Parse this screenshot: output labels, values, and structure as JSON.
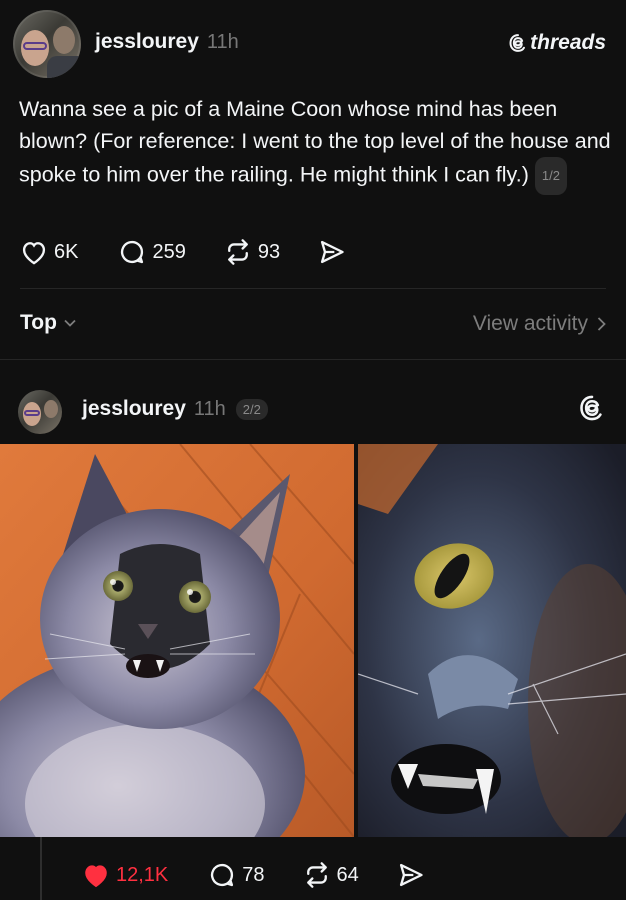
{
  "post1": {
    "username": "jesslourey",
    "time": "11h",
    "brand": "threads",
    "text": "Wanna see a pic of a Maine Coon whose mind has been blown? (For reference: I went to the top level of the house and spoke to him over the railing. He might think I can fly.)",
    "pager": "1/2",
    "likes": "6K",
    "replies": "259",
    "reposts": "93"
  },
  "replies_bar": {
    "sort_label": "Top",
    "view_activity": "View activity"
  },
  "post2": {
    "username": "jesslourey",
    "time": "11h",
    "pager": "2/2",
    "likes": "12,1K",
    "replies": "78",
    "reposts": "64",
    "liked": true
  },
  "colors": {
    "background": "#101010",
    "text": "#f3f5f7",
    "muted": "#777777",
    "like_red": "#ff3040"
  },
  "icons": [
    "heart-icon",
    "comment-icon",
    "repost-icon",
    "share-icon",
    "threads-logo-icon",
    "chevron-down-icon",
    "chevron-right-icon"
  ]
}
